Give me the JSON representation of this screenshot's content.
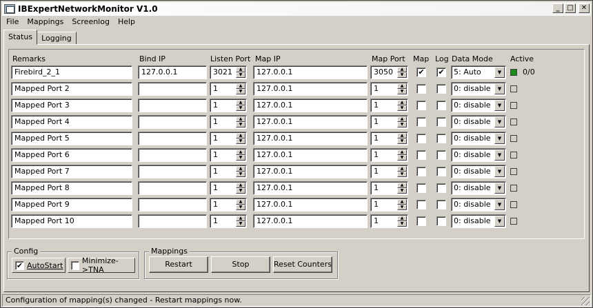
{
  "window": {
    "title": "IBExpertNetworkMonitor V1.0"
  },
  "title_buttons": {
    "minimize": "_",
    "maximize": "□",
    "close": "✕"
  },
  "menu": [
    "File",
    "Mappings",
    "Screenlog",
    "Help"
  ],
  "tabs": [
    {
      "label": "Status",
      "active": true
    },
    {
      "label": "Logging",
      "active": false
    }
  ],
  "columns": {
    "remarks": "Remarks",
    "bind_ip": "Bind IP",
    "listen_port": "Listen Port",
    "map_ip": "Map IP",
    "map_port": "Map Port",
    "map": "Map",
    "log": "Log",
    "data_mode": "Data Mode",
    "active": "Active"
  },
  "rows": [
    {
      "remarks": "Firebird_2_1",
      "bind_ip": "127.0.0.1",
      "listen_port": "3021",
      "map_ip": "127.0.0.1",
      "map_port": "3050",
      "map": "✔",
      "log": "✔",
      "data_mode": "5: Auto",
      "active": true,
      "count": "0/0"
    },
    {
      "remarks": "Mapped Port 2",
      "bind_ip": "",
      "listen_port": "1",
      "map_ip": "127.0.0.1",
      "map_port": "1",
      "map": "",
      "log": "",
      "data_mode": "0: disable",
      "active": false,
      "count": ""
    },
    {
      "remarks": "Mapped Port 3",
      "bind_ip": "",
      "listen_port": "1",
      "map_ip": "127.0.0.1",
      "map_port": "1",
      "map": "",
      "log": "",
      "data_mode": "0: disable",
      "active": false,
      "count": ""
    },
    {
      "remarks": "Mapped Port 4",
      "bind_ip": "",
      "listen_port": "1",
      "map_ip": "127.0.0.1",
      "map_port": "1",
      "map": "",
      "log": "",
      "data_mode": "0: disable",
      "active": false,
      "count": ""
    },
    {
      "remarks": "Mapped Port 5",
      "bind_ip": "",
      "listen_port": "1",
      "map_ip": "127.0.0.1",
      "map_port": "1",
      "map": "",
      "log": "",
      "data_mode": "0: disable",
      "active": false,
      "count": ""
    },
    {
      "remarks": "Mapped Port 6",
      "bind_ip": "",
      "listen_port": "1",
      "map_ip": "127.0.0.1",
      "map_port": "1",
      "map": "",
      "log": "",
      "data_mode": "0: disable",
      "active": false,
      "count": ""
    },
    {
      "remarks": "Mapped Port 7",
      "bind_ip": "",
      "listen_port": "1",
      "map_ip": "127.0.0.1",
      "map_port": "1",
      "map": "",
      "log": "",
      "data_mode": "0: disable",
      "active": false,
      "count": ""
    },
    {
      "remarks": "Mapped Port 8",
      "bind_ip": "",
      "listen_port": "1",
      "map_ip": "127.0.0.1",
      "map_port": "1",
      "map": "",
      "log": "",
      "data_mode": "0: disable",
      "active": false,
      "count": ""
    },
    {
      "remarks": "Mapped Port 9",
      "bind_ip": "",
      "listen_port": "1",
      "map_ip": "127.0.0.1",
      "map_port": "1",
      "map": "",
      "log": "",
      "data_mode": "0: disable",
      "active": false,
      "count": ""
    },
    {
      "remarks": "Mapped Port 10",
      "bind_ip": "",
      "listen_port": "1",
      "map_ip": "127.0.0.1",
      "map_port": "1",
      "map": "",
      "log": "",
      "data_mode": "0: disable",
      "active": false,
      "count": ""
    }
  ],
  "config": {
    "title": "Config",
    "autostart": {
      "label": "AutoStart",
      "checked": "✔"
    },
    "minimize": {
      "label": "Minimize->TNA",
      "checked": ""
    }
  },
  "mappings": {
    "title": "Mappings",
    "restart": "Restart",
    "stop": "Stop",
    "reset_counters": "Reset Counters"
  },
  "status": "Configuration of mapping(s) changed - Restart mappings now.",
  "colors": {
    "active_led": "#1a8a1a",
    "face": "#d4d0c8"
  }
}
